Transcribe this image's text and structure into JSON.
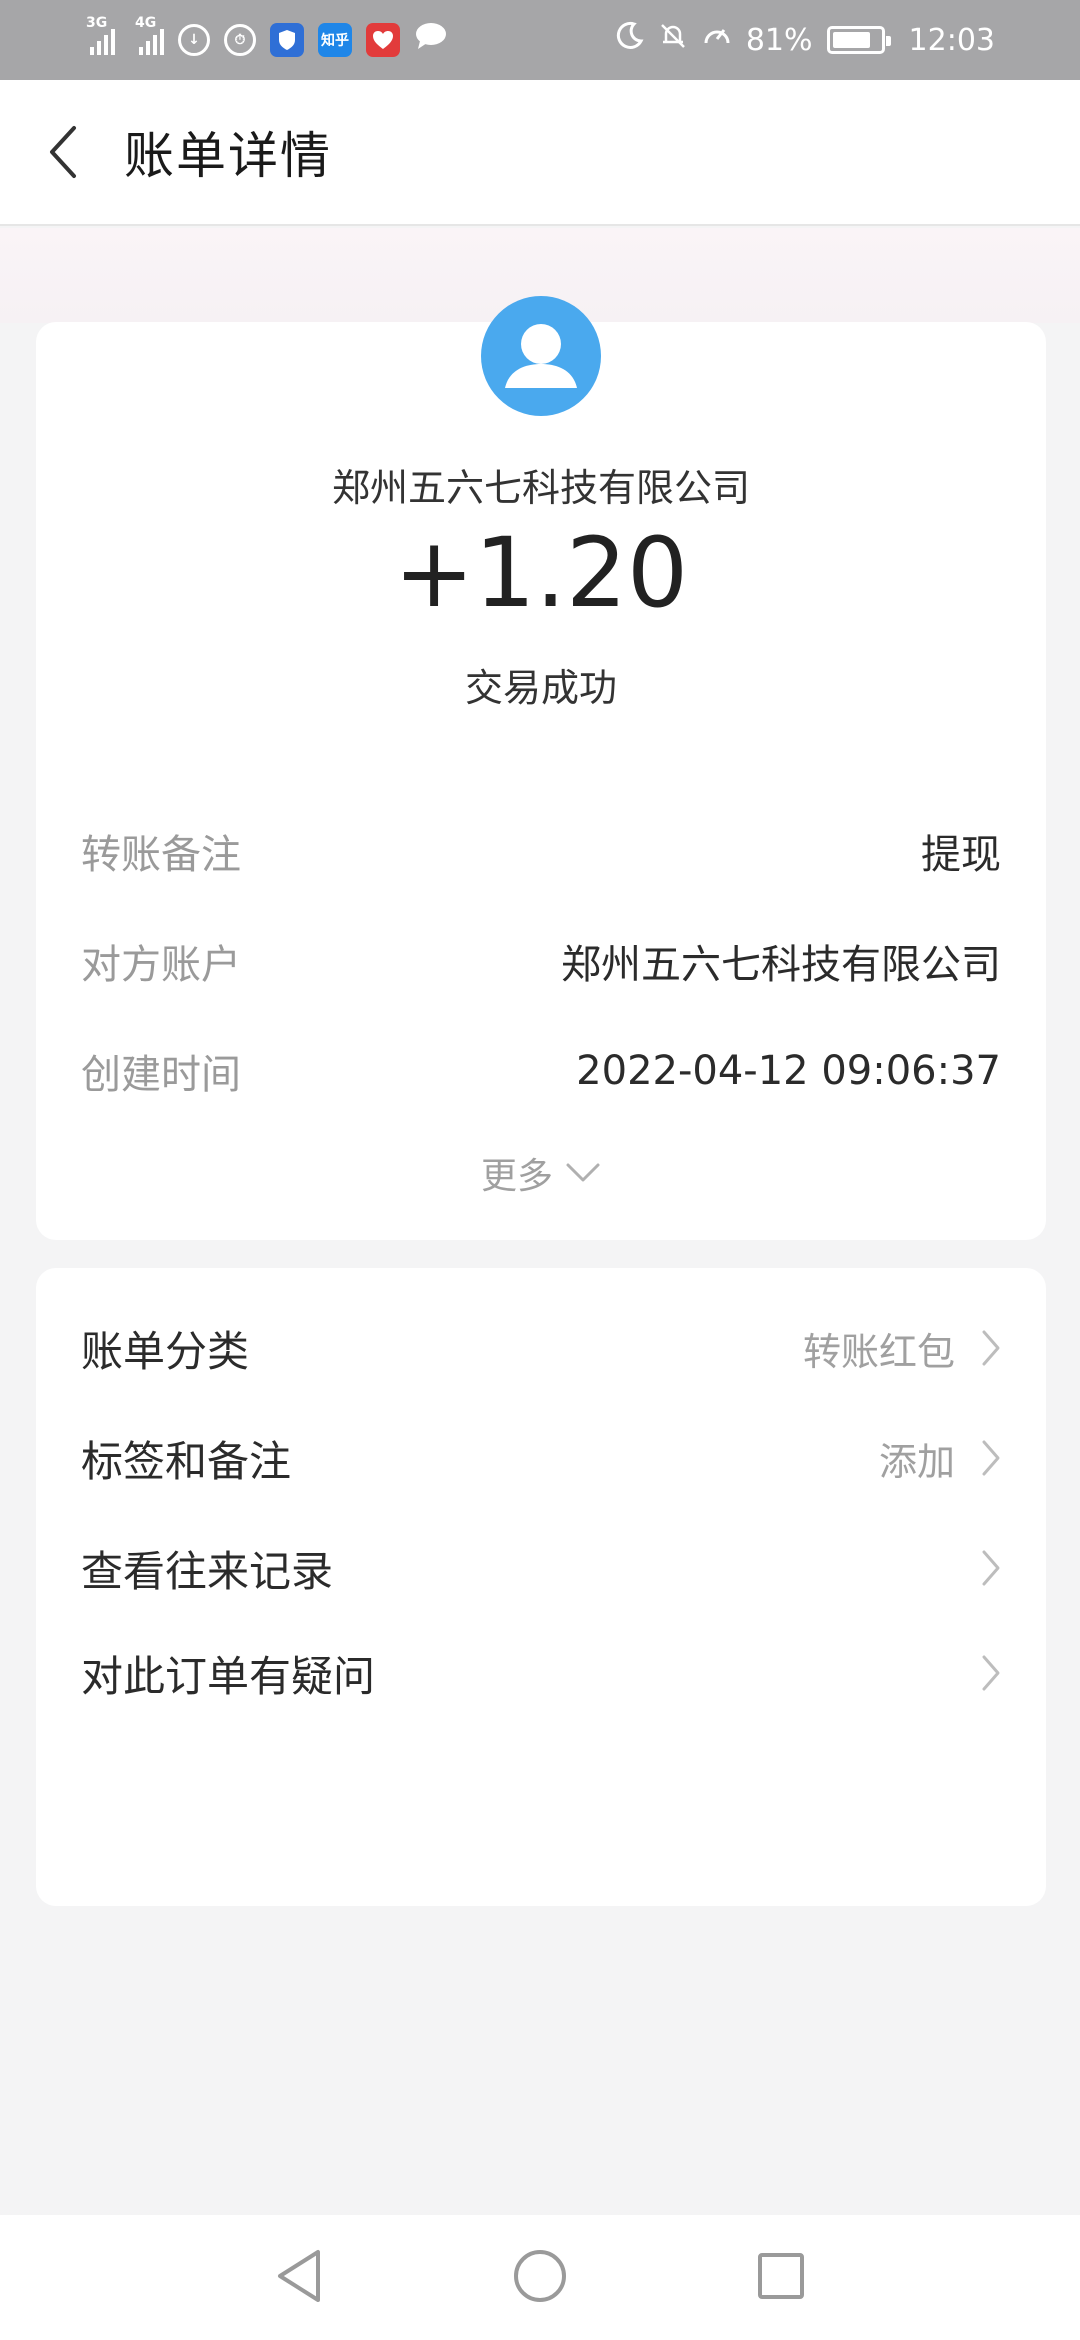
{
  "status_bar": {
    "net1": "3G",
    "net2": "4G",
    "zhihu": "知乎",
    "battery": "81%",
    "battery_level": 0.81,
    "time": "12:03"
  },
  "header": {
    "title": "账单详情"
  },
  "transaction": {
    "merchant": "郑州五六七科技有限公司",
    "amount": "+1.20",
    "status": "交易成功"
  },
  "details": [
    {
      "label": "转账备注",
      "value": "提现"
    },
    {
      "label": "对方账户",
      "value": "郑州五六七科技有限公司"
    },
    {
      "label": "创建时间",
      "value": "2022-04-12 09:06:37"
    }
  ],
  "more_label": "更多",
  "menu": [
    {
      "label": "账单分类",
      "value": "转账红包"
    },
    {
      "label": "标签和备注",
      "value": "添加"
    },
    {
      "label": "查看往来记录",
      "value": ""
    },
    {
      "label": "对此订单有疑问",
      "value": ""
    }
  ],
  "colors": {
    "avatar_bg": "#4aa9ee",
    "status_bar_bg": "#a6a6a8"
  }
}
